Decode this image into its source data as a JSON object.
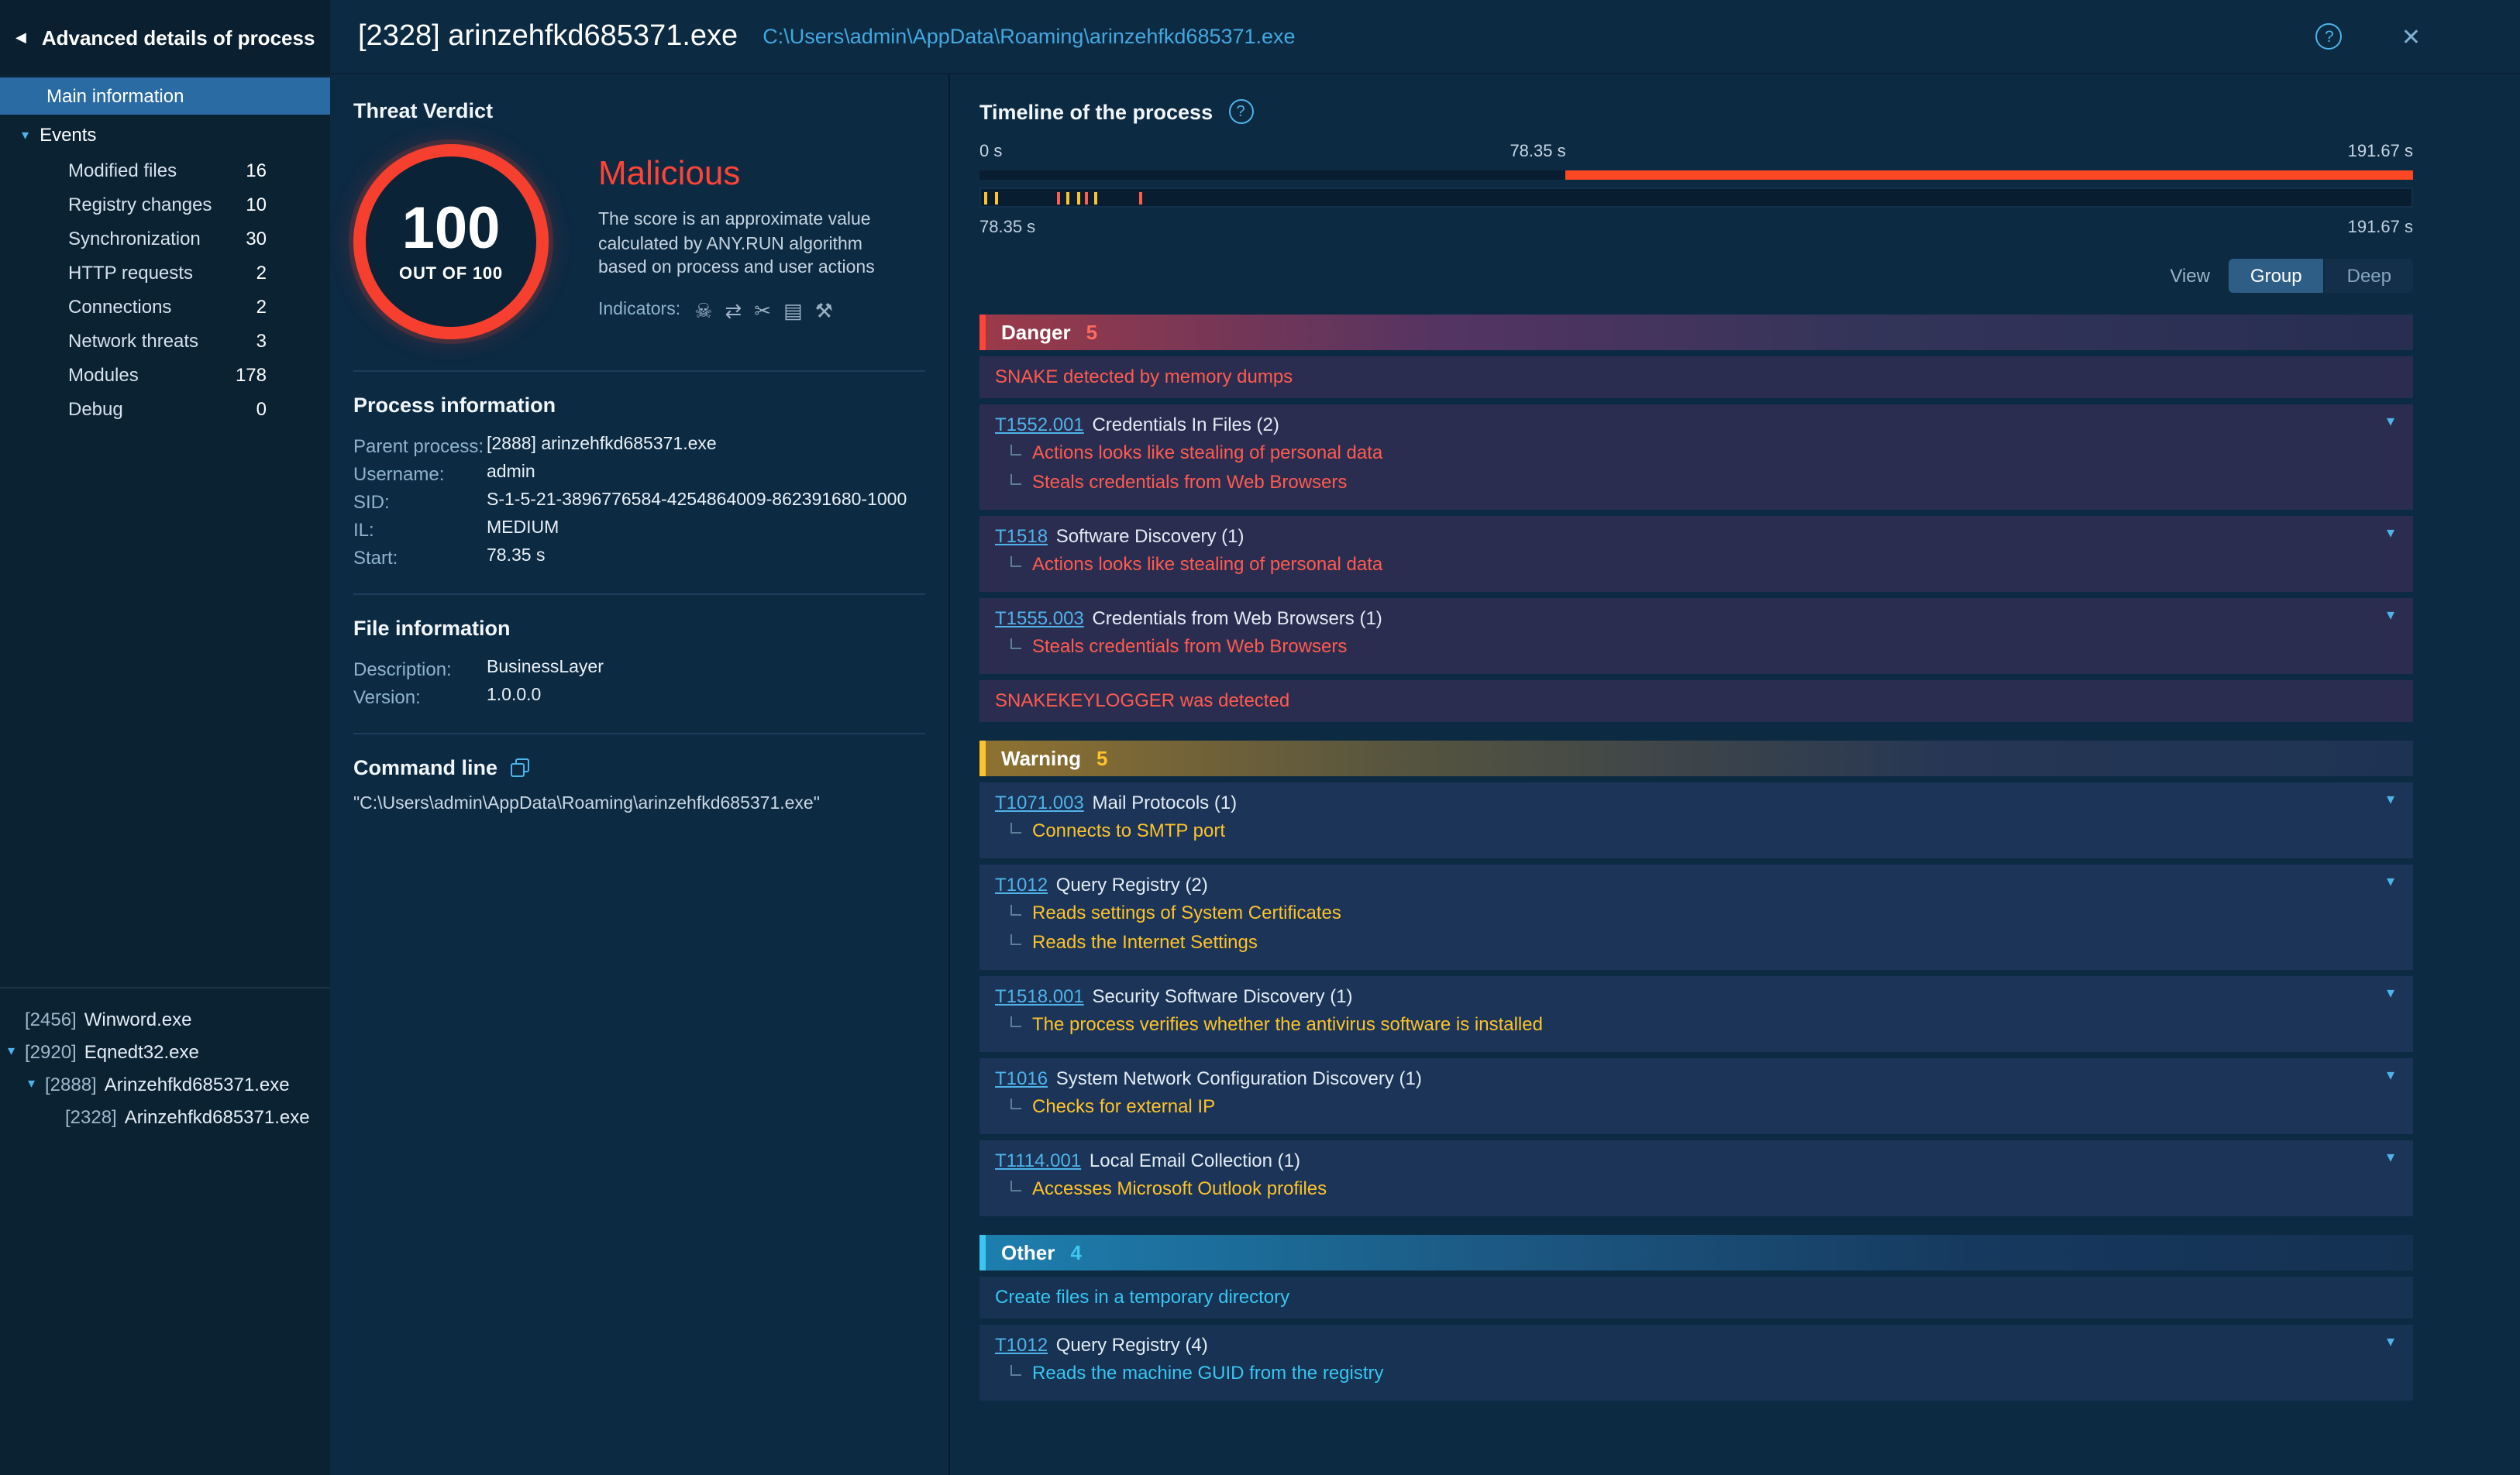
{
  "sidebar": {
    "back_icon": "◀",
    "title": "Advanced details of process",
    "main_item": "Main information",
    "events_caret": "▾",
    "events_label": "Events",
    "event_items": [
      {
        "label": "Modified files",
        "count": "16"
      },
      {
        "label": "Registry changes",
        "count": "10"
      },
      {
        "label": "Synchronization",
        "count": "30"
      },
      {
        "label": "HTTP requests",
        "count": "2"
      },
      {
        "label": "Connections",
        "count": "2"
      },
      {
        "label": "Network threats",
        "count": "3"
      },
      {
        "label": "Modules",
        "count": "178"
      },
      {
        "label": "Debug",
        "count": "0"
      }
    ],
    "process_tree": [
      {
        "pid": "[2456]",
        "name": "Winword.exe",
        "level": 0,
        "expanded": false
      },
      {
        "pid": "[2920]",
        "name": "Eqnedt32.exe",
        "level": 0,
        "expanded": true
      },
      {
        "pid": "[2888]",
        "name": "Arinzehfkd685371.exe",
        "level": 1,
        "expanded": true
      },
      {
        "pid": "[2328]",
        "name": "Arinzehfkd685371.exe",
        "level": 2,
        "expanded": false
      }
    ]
  },
  "header": {
    "title": "[2328] arinzehfkd685371.exe",
    "path": "C:\\Users\\admin\\AppData\\Roaming\\arinzehfkd685371.exe",
    "help_glyph": "?",
    "close_glyph": "✕"
  },
  "verdict": {
    "section_title": "Threat Verdict",
    "score": "100",
    "score_caption": "OUT OF 100",
    "label": "Malicious",
    "label_color": "#ff4334",
    "description": "The score is an approximate value calculated by ANY.RUN algorithm based on process and user actions",
    "indicators_label": "Indicators:",
    "indicators": [
      {
        "name": "skull-icon",
        "glyph": "☠"
      },
      {
        "name": "swap-arrows-icon",
        "glyph": "⇄"
      },
      {
        "name": "scissors-icon",
        "glyph": "✂"
      },
      {
        "name": "card-icon",
        "glyph": "▤"
      },
      {
        "name": "tools-icon",
        "glyph": "⚒"
      }
    ]
  },
  "process_info": {
    "title": "Process information",
    "rows": [
      {
        "label": "Parent process:",
        "value": "[2888] arinzehfkd685371.exe"
      },
      {
        "label": "Username:",
        "value": "admin"
      },
      {
        "label": "SID:",
        "value": "S-1-5-21-3896776584-4254864009-862391680-1000"
      },
      {
        "label": "IL:",
        "value": "MEDIUM"
      },
      {
        "label": "Start:",
        "value": "78.35 s"
      }
    ]
  },
  "file_info": {
    "title": "File information",
    "rows": [
      {
        "label": "Description:",
        "value": "BusinessLayer"
      },
      {
        "label": "Version:",
        "value": "1.0.0.0"
      }
    ]
  },
  "command_line": {
    "title": "Command line",
    "value": "\"C:\\Users\\admin\\AppData\\Roaming\\arinzehfkd685371.exe\""
  },
  "timeline": {
    "title": "Timeline of the process",
    "help_glyph": "?",
    "scale_start": "0 s",
    "scale_mid": "78.35 s",
    "scale_end": "191.67 s",
    "range_start": "78.35 s",
    "range_end": "191.67 s",
    "lifetime_start_fraction": 0.409,
    "lifetime_color": "#fb4822",
    "ticks": [
      {
        "pos": 0.002,
        "color": "#fdc32a"
      },
      {
        "pos": 0.01,
        "color": "#fdc32a"
      },
      {
        "pos": 0.053,
        "color": "#ff5b4f"
      },
      {
        "pos": 0.06,
        "color": "#fdc32a"
      },
      {
        "pos": 0.067,
        "color": "#fdc32a"
      },
      {
        "pos": 0.073,
        "color": "#ff5b4f"
      },
      {
        "pos": 0.079,
        "color": "#fdc32a"
      },
      {
        "pos": 0.11,
        "color": "#ff5b4f"
      }
    ],
    "view_label": "View",
    "view_options": [
      {
        "label": "Group",
        "active": true
      },
      {
        "label": "Deep",
        "active": false
      }
    ]
  },
  "behavior": {
    "sections": [
      {
        "kind": "danger",
        "label": "Danger",
        "count": "5",
        "accent": "#ff4334",
        "count_color": "#ff6a5c",
        "item_color": "#ff5b4f",
        "items": [
          {
            "type": "signature",
            "text": "SNAKE detected by memory dumps"
          },
          {
            "type": "technique",
            "id": "T1552.001",
            "name": "Credentials In Files (2)",
            "subs": [
              "Actions looks like stealing of personal data",
              "Steals credentials from Web Browsers"
            ]
          },
          {
            "type": "technique",
            "id": "T1518",
            "name": "Software Discovery (1)",
            "subs": [
              "Actions looks like stealing of personal data"
            ]
          },
          {
            "type": "technique",
            "id": "T1555.003",
            "name": "Credentials from Web Browsers (1)",
            "subs": [
              "Steals credentials from Web Browsers"
            ]
          },
          {
            "type": "signature",
            "text": "SNAKEKEYLOGGER was detected"
          }
        ]
      },
      {
        "kind": "warning",
        "label": "Warning",
        "count": "5",
        "accent": "#fdc32a",
        "count_color": "#fdc32a",
        "item_color": "#fdc32a",
        "items": [
          {
            "type": "technique",
            "id": "T1071.003",
            "name": "Mail Protocols (1)",
            "subs": [
              "Connects to SMTP port"
            ]
          },
          {
            "type": "technique",
            "id": "T1012",
            "name": "Query Registry (2)",
            "subs": [
              "Reads settings of System Certificates",
              "Reads the Internet Settings"
            ]
          },
          {
            "type": "technique",
            "id": "T1518.001",
            "name": "Security Software Discovery (1)",
            "subs": [
              "The process verifies whether the antivirus software is installed"
            ]
          },
          {
            "type": "technique",
            "id": "T1016",
            "name": "System Network Configuration Discovery (1)",
            "subs": [
              "Checks for external IP"
            ]
          },
          {
            "type": "technique",
            "id": "T1114.001",
            "name": "Local Email Collection (1)",
            "subs": [
              "Accesses Microsoft Outlook profiles"
            ]
          }
        ]
      },
      {
        "kind": "other",
        "label": "Other",
        "count": "4",
        "accent": "#38c6f2",
        "count_color": "#3fc6f2",
        "item_color": "#38c6f2",
        "items": [
          {
            "type": "signature",
            "text": "Create files in a temporary directory"
          },
          {
            "type": "technique",
            "id": "T1012",
            "name": "Query Registry (4)",
            "subs": [
              "Reads the machine GUID from the registry"
            ]
          }
        ]
      }
    ]
  }
}
